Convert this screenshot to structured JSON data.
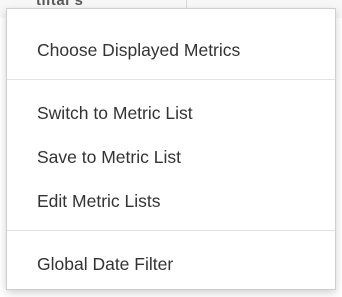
{
  "background": {
    "partial_header_text": "tiital s"
  },
  "menu": {
    "sections": [
      {
        "items": [
          {
            "label": "Choose Displayed Metrics"
          }
        ]
      },
      {
        "items": [
          {
            "label": "Switch to Metric List"
          },
          {
            "label": "Save to Metric List"
          },
          {
            "label": "Edit Metric Lists"
          }
        ]
      },
      {
        "items": [
          {
            "label": "Global Date Filter"
          }
        ]
      }
    ]
  }
}
